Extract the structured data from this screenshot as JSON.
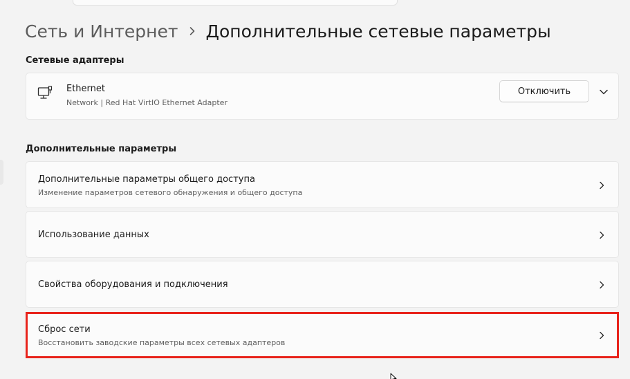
{
  "breadcrumb": {
    "parent": "Сеть и Интернет",
    "current": "Дополнительные сетевые параметры"
  },
  "adapters_section": {
    "title": "Сетевые адаптеры",
    "items": [
      {
        "name": "Ethernet",
        "description": "Network | Red Hat VirtIO Ethernet Adapter",
        "button_label": "Отключить",
        "icon": "ethernet-adapter-icon"
      }
    ]
  },
  "more_section": {
    "title": "Дополнительные параметры",
    "items": [
      {
        "title": "Дополнительные параметры общего доступа",
        "subtitle": "Изменение параметров сетевого обнаружения и общего доступа"
      },
      {
        "title": "Использование данных"
      },
      {
        "title": "Свойства оборудования и подключения"
      },
      {
        "title": "Сброс сети",
        "subtitle": "Восстановить заводские параметры всех сетевых адаптеров",
        "highlighted": true
      }
    ]
  },
  "colors": {
    "background": "#f3f3f3",
    "card": "#fbfbfb",
    "highlight_border": "#e8231b",
    "text_primary": "#1b1b1b",
    "text_secondary": "#5f5f5f"
  }
}
